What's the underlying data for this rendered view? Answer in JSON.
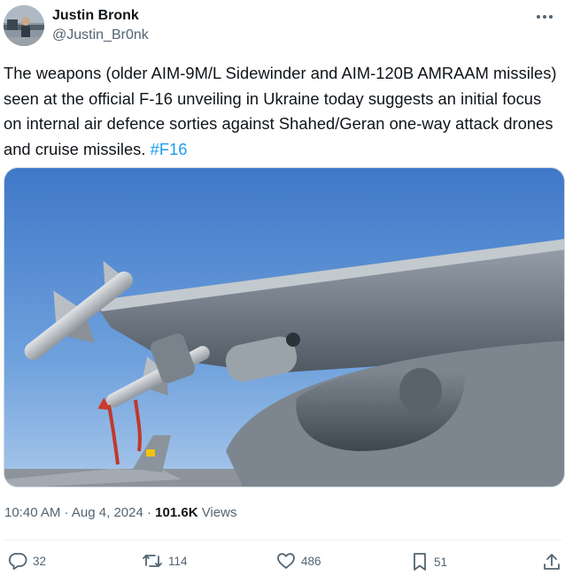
{
  "author": {
    "display_name": "Justin Bronk",
    "handle": "@Justin_Br0nk"
  },
  "tweet": {
    "text": "The weapons (older AIM-9M/L Sidewinder and AIM-120B AMRAAM missiles) seen at the official F-16 unveiling in Ukraine today suggests an initial focus on internal air defence sorties against Shahed/Geran one-way attack drones and cruise missiles. ",
    "hashtag": "#F16"
  },
  "meta": {
    "time": "10:40 AM",
    "separator_1": " · ",
    "date": "Aug 4, 2024",
    "separator_2": " · ",
    "views_count": "101.6K",
    "views_label": " Views"
  },
  "actions": {
    "replies": "32",
    "reposts": "114",
    "likes": "486",
    "bookmarks": "51"
  },
  "icons": {
    "more": "more-horizontal-icon",
    "reply": "reply-icon",
    "repost": "repost-icon",
    "like": "heart-icon",
    "bookmark": "bookmark-icon",
    "share": "share-icon"
  },
  "colors": {
    "text": "#0f1419",
    "secondary": "#536471",
    "link": "#1d9bf0"
  }
}
